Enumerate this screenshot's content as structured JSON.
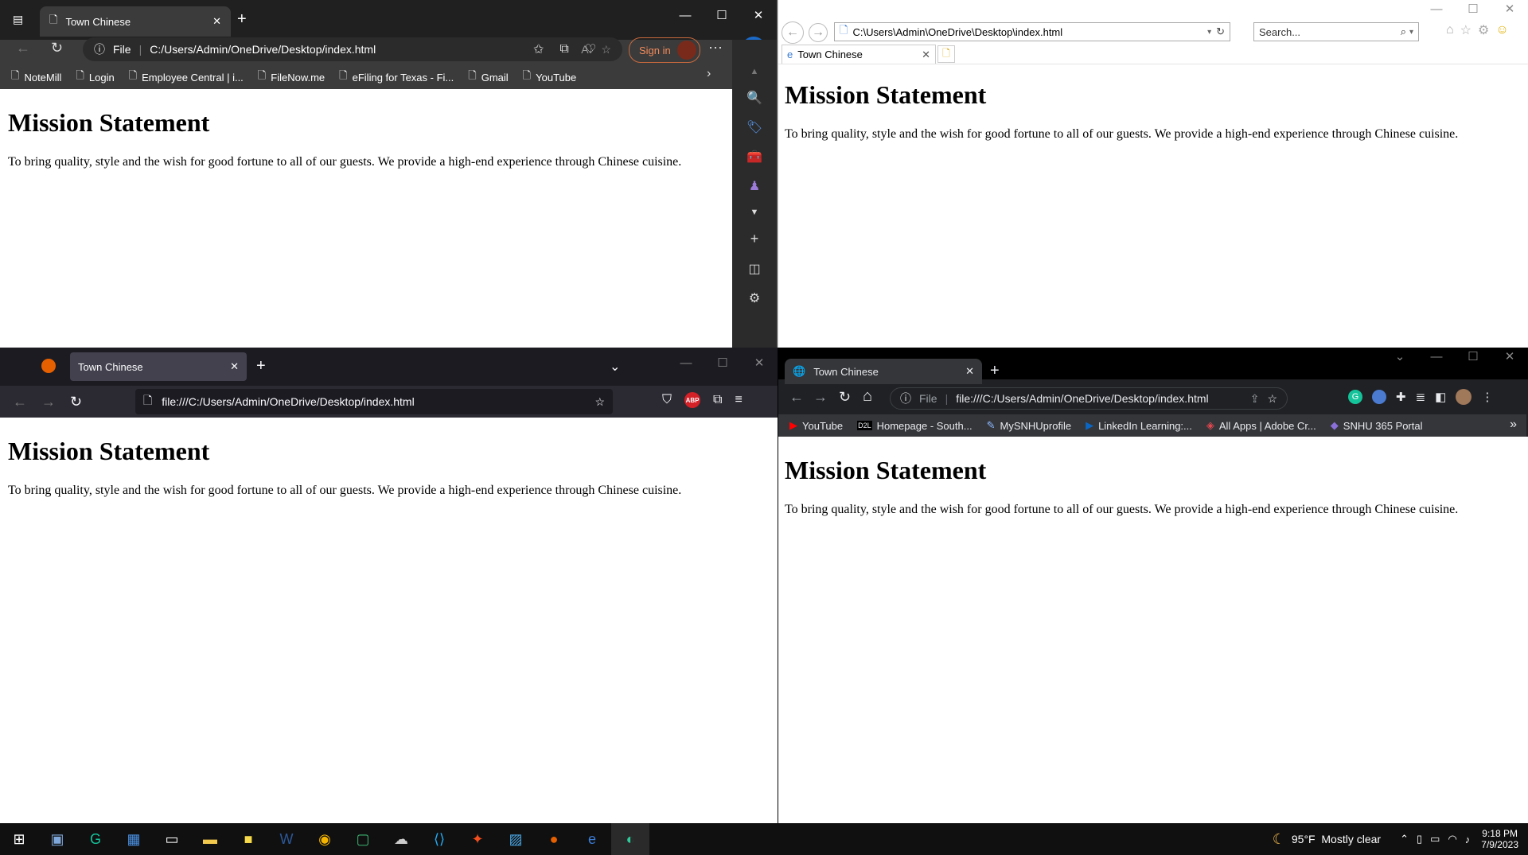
{
  "edge": {
    "tab_title": "Town Chinese",
    "file_label": "File",
    "url": "C:/Users/Admin/OneDrive/Desktop/index.html",
    "signin": "Sign in",
    "bookmarks": [
      "NoteMill",
      "Login",
      "Employee Central | i...",
      "FileNow.me",
      "eFiling for Texas - Fi...",
      "Gmail",
      "YouTube"
    ]
  },
  "ie": {
    "url": "C:\\Users\\Admin\\OneDrive\\Desktop\\index.html",
    "search_placeholder": "Search...",
    "tab_title": "Town Chinese"
  },
  "firefox": {
    "tab_title": "Town Chinese",
    "url": "file:///C:/Users/Admin/OneDrive/Desktop/index.html",
    "abp": "ABP"
  },
  "chrome": {
    "tab_title": "Town Chinese",
    "file_label": "File",
    "url": "file:///C:/Users/Admin/OneDrive/Desktop/index.html",
    "bookmarks": [
      "YouTube",
      "Homepage - South...",
      "MySNHUprofile",
      "LinkedIn Learning:...",
      "All Apps | Adobe Cr...",
      "SNHU 365 Portal"
    ]
  },
  "page": {
    "heading": "Mission Statement",
    "body": "To bring quality, style and the wish for good fortune to all of our guests. We provide a high-end experience through Chinese cuisine."
  },
  "taskbar": {
    "weather": "95°F  Mostly clear",
    "time": "9:18 PM",
    "date": "7/9/2023"
  }
}
